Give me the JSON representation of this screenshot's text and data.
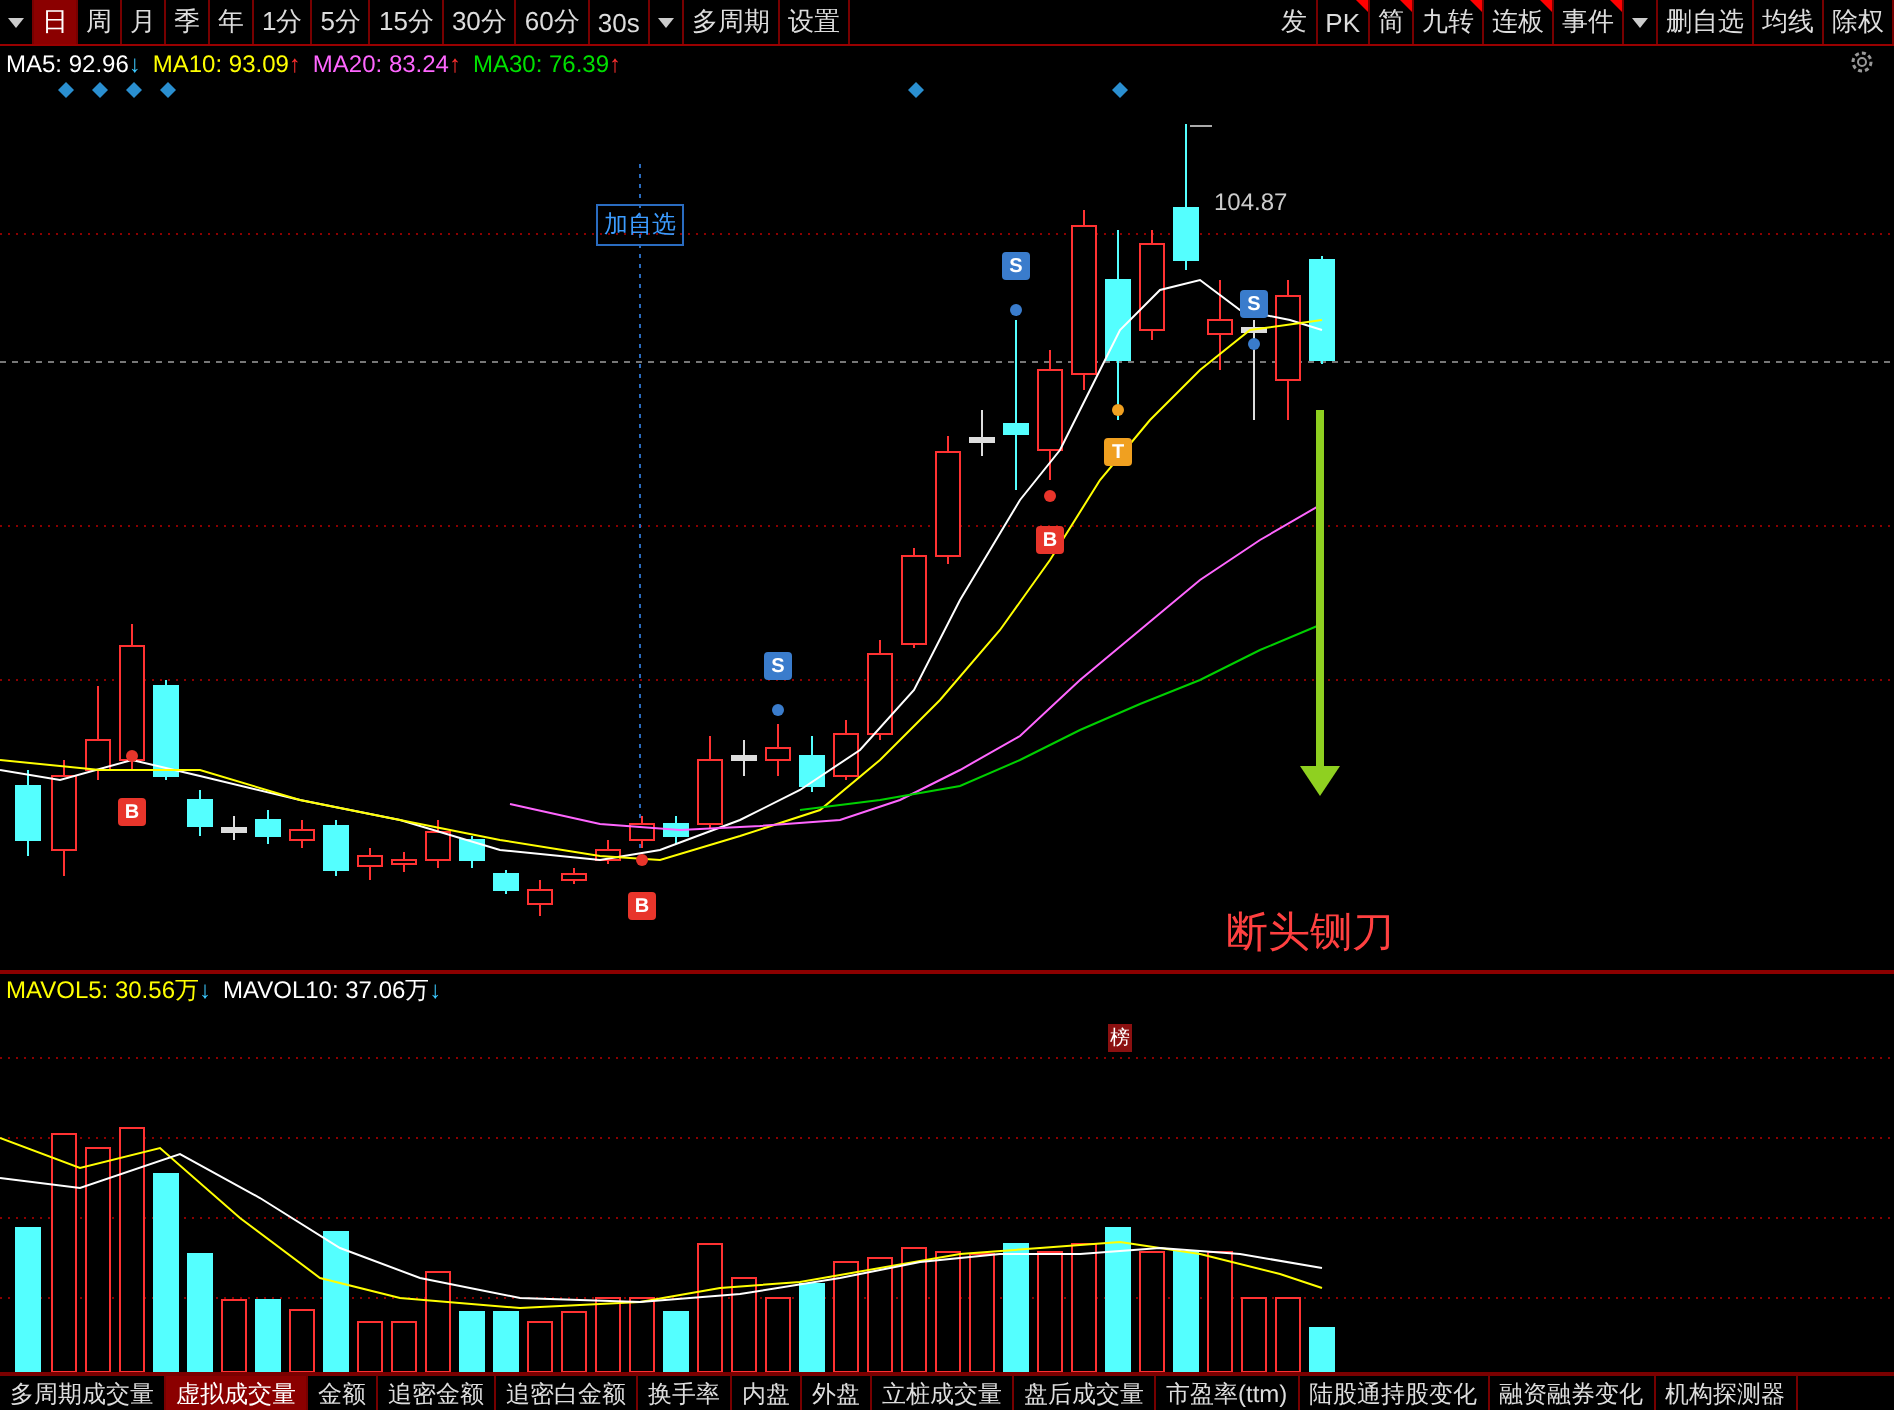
{
  "toolbar": {
    "periods": [
      {
        "label": "日",
        "selected": true
      },
      {
        "label": "周",
        "selected": false
      },
      {
        "label": "月",
        "selected": false
      },
      {
        "label": "季",
        "selected": false
      },
      {
        "label": "年",
        "selected": false
      },
      {
        "label": "1分",
        "selected": false
      },
      {
        "label": "5分",
        "selected": false
      },
      {
        "label": "15分",
        "selected": false
      },
      {
        "label": "30分",
        "selected": false
      },
      {
        "label": "60分",
        "selected": false
      },
      {
        "label": "30s",
        "selected": false
      }
    ],
    "period_menu": [
      "多周期",
      "设置"
    ],
    "tools": [
      {
        "label": "发",
        "flagged": false
      },
      {
        "label": "PK",
        "flagged": true
      },
      {
        "label": "简",
        "flagged": true
      },
      {
        "label": "九转",
        "flagged": true
      },
      {
        "label": "连板",
        "flagged": true
      },
      {
        "label": "事件",
        "flagged": true
      }
    ],
    "tool_menu": [
      "删自选",
      "均线",
      "除权"
    ]
  },
  "ma_legend": [
    {
      "label": "MA5: 92.96",
      "arrow": "↓",
      "kind": "falling",
      "color": "#ffffff"
    },
    {
      "label": "MA10: 93.09",
      "arrow": "↑",
      "kind": "rising",
      "color": "#ffff00"
    },
    {
      "label": "MA20: 83.24",
      "arrow": "↑",
      "kind": "rising",
      "color": "#ff66ff"
    },
    {
      "label": "MA30: 76.39",
      "arrow": "↑",
      "kind": "rising",
      "color": "#00e000"
    }
  ],
  "chart": {
    "watchlist_tag": "加自选",
    "high_price": "104.87",
    "annotation": "断头铡刀",
    "rank_badge": "榜",
    "signals": [
      {
        "label": "B",
        "kind": "buy"
      },
      {
        "label": "B",
        "kind": "buy"
      },
      {
        "label": "S",
        "kind": "sell"
      },
      {
        "label": "S",
        "kind": "sell"
      },
      {
        "label": "B",
        "kind": "buy"
      },
      {
        "label": "T",
        "kind": "t"
      },
      {
        "label": "S",
        "kind": "sell"
      }
    ]
  },
  "volume_legend": [
    {
      "label": "MAVOL5: 30.56万",
      "arrow": "↓",
      "kind": "falling",
      "color": "#ffff00"
    },
    {
      "label": "MAVOL10: 37.06万",
      "arrow": "↓",
      "kind": "falling",
      "color": "#ffffff"
    }
  ],
  "bottom_tabs": [
    {
      "label": "多周期成交量",
      "selected": false
    },
    {
      "label": "虚拟成交量",
      "selected": true
    },
    {
      "label": "金额",
      "selected": false
    },
    {
      "label": "追密金额",
      "selected": false
    },
    {
      "label": "追密白金额",
      "selected": false
    },
    {
      "label": "换手率",
      "selected": false
    },
    {
      "label": "内盘",
      "selected": false
    },
    {
      "label": "外盘",
      "selected": false
    },
    {
      "label": "立桩成交量",
      "selected": false
    },
    {
      "label": "盘后成交量",
      "selected": false
    },
    {
      "label": "市盈率(ttm)",
      "selected": false
    },
    {
      "label": "陆股通持股变化",
      "selected": false
    },
    {
      "label": "融资融券变化",
      "selected": false
    },
    {
      "label": "机构探测器",
      "selected": false
    }
  ]
}
